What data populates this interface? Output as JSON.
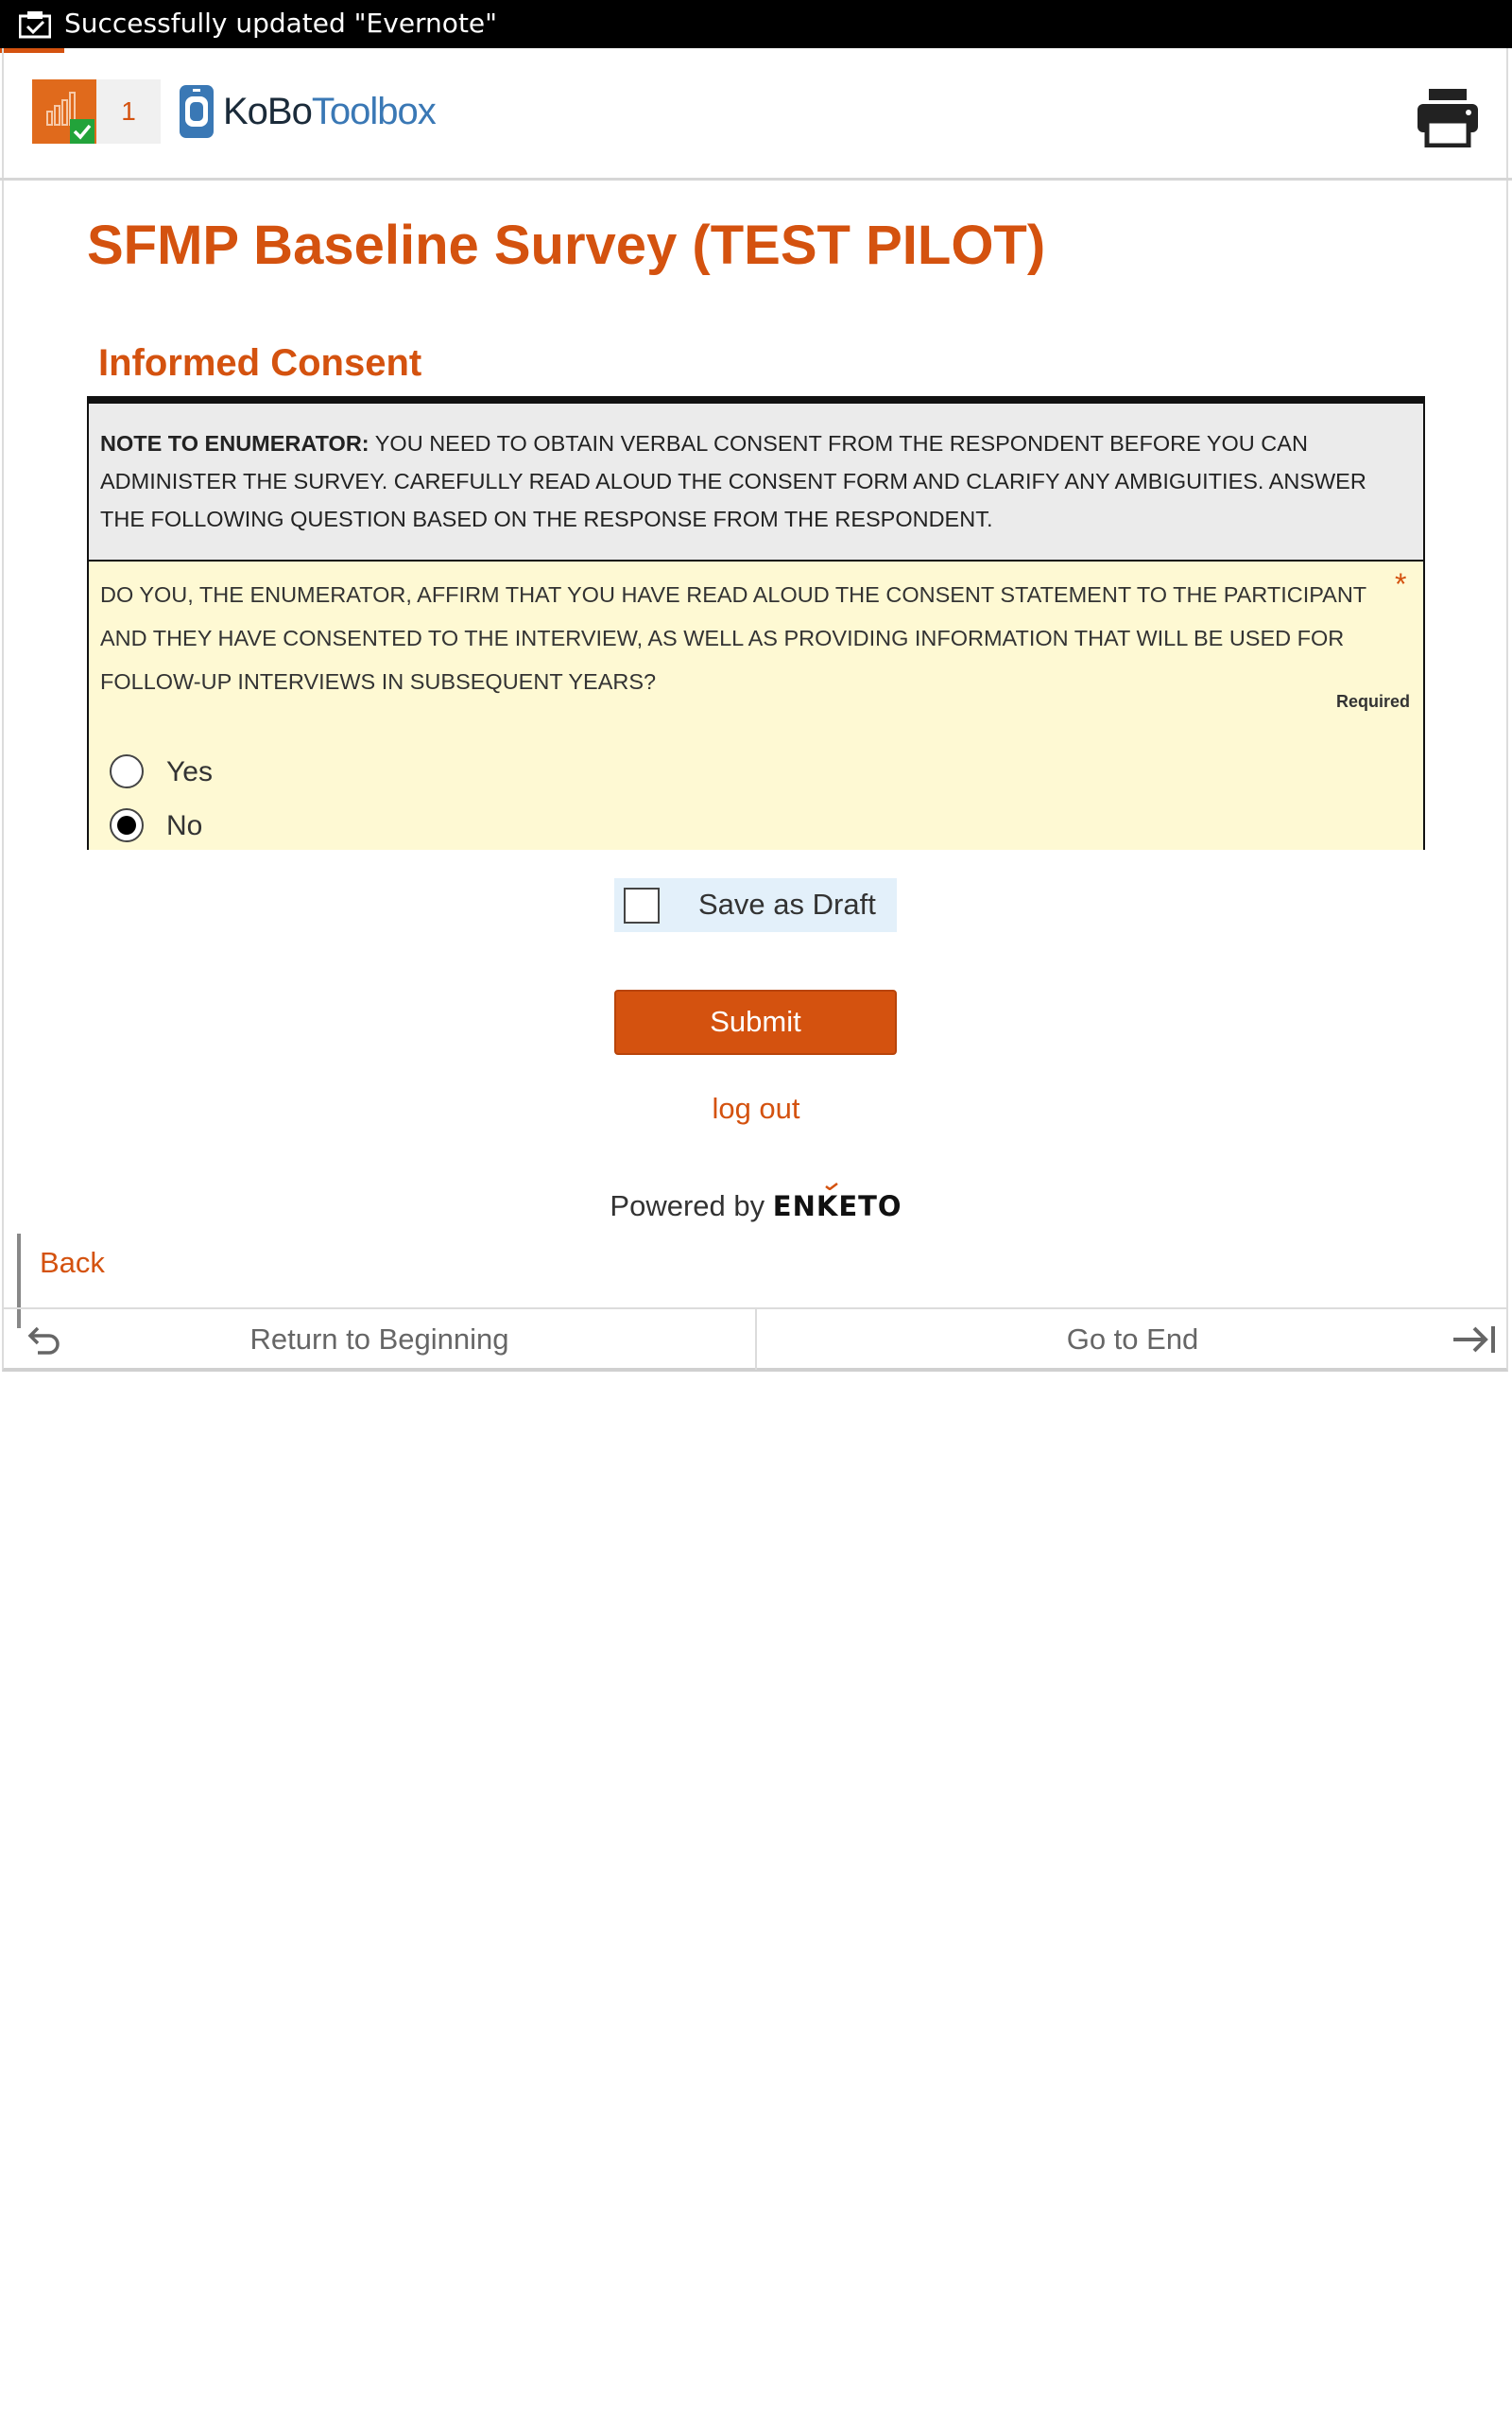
{
  "status_bar": {
    "notification_text": "Successfully updated \"Evernote\"",
    "icon": "clipboard-check-icon"
  },
  "header": {
    "queue_count": "1",
    "logo_part1": "KoBo",
    "logo_part2": "Toolbox",
    "print_icon": "printer-icon"
  },
  "form": {
    "title": "SFMP Baseline Survey (TEST PILOT)",
    "group_title": "Informed Consent",
    "note_prefix": "NOTE TO ENUMERATOR:",
    "note_text": "YOU NEED TO OBTAIN VERBAL CONSENT FROM THE RESPONDENT BEFORE YOU CAN ADMINISTER THE SURVEY. CAREFULLY READ ALOUD THE CONSENT FORM AND CLARIFY ANY AMBIGUITIES. ANSWER THE FOLLOWING QUESTION BASED ON THE RESPONSE FROM THE RESPONDENT.",
    "question_text": "DO YOU, THE ENUMERATOR, AFFIRM THAT YOU HAVE READ ALOUD THE CONSENT STATEMENT TO THE PARTICIPANT AND THEY HAVE CONSENTED TO THE INTERVIEW, AS WELL AS PROVIDING INFORMATION THAT WILL BE USED FOR FOLLOW-UP INTERVIEWS IN SUBSEQUENT YEARS?",
    "required_star": "*",
    "required_label": "Required",
    "options": [
      {
        "label": "Yes",
        "checked": false
      },
      {
        "label": "No",
        "checked": true
      }
    ]
  },
  "actions": {
    "save_draft_label": "Save as Draft",
    "save_draft_checked": false,
    "submit_label": "Submit",
    "logout_label": "log out",
    "powered_by": "Powered by",
    "enketo_brand": "ENKETO"
  },
  "navigation": {
    "back_label": "Back",
    "return_label": "Return to Beginning",
    "end_label": "Go to End"
  },
  "colors": {
    "accent": "#d4520f",
    "question_bg": "#fef9d3",
    "note_bg": "#ebebeb",
    "draft_bg": "#e3f0fa"
  }
}
